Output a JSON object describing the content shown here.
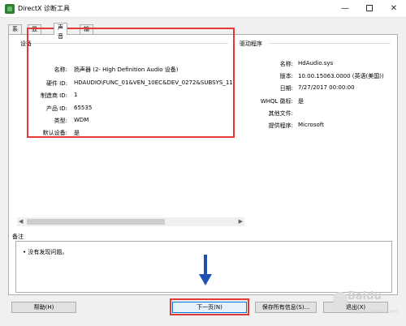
{
  "window": {
    "title": "DirectX 诊断工具",
    "controls": {
      "minimize": "—",
      "close": "✕"
    }
  },
  "tabs": [
    {
      "label": "系统"
    },
    {
      "label": "显示"
    },
    {
      "label": "声音"
    },
    {
      "label": "输入"
    }
  ],
  "device": {
    "group_title": "设备",
    "rows": [
      {
        "label": "名称:",
        "value": "扬声器 (2- High Definition Audio 设备)"
      },
      {
        "label": "硬件 ID:",
        "value": "HDAUDIO\\FUNC_01&VEN_10EC&DEV_0272&SUBSYS_11"
      },
      {
        "label": "制造商 ID:",
        "value": "1"
      },
      {
        "label": "产品 ID:",
        "value": "65535"
      },
      {
        "label": "类型:",
        "value": "WDM"
      },
      {
        "label": "默认设备:",
        "value": "是"
      }
    ]
  },
  "driver": {
    "group_title": "驱动程序",
    "rows": [
      {
        "label": "名称:",
        "value": "HdAudio.sys"
      },
      {
        "label": "版本:",
        "value": "10.00.15063.0000 (英语(美国))"
      },
      {
        "label": "日期:",
        "value": "7/27/2017 00:00:00"
      },
      {
        "label": "WHQL 徽标:",
        "value": "是"
      },
      {
        "label": "其他文件:",
        "value": ""
      },
      {
        "label": "提供程序:",
        "value": "Microsoft"
      }
    ]
  },
  "notes": {
    "label": "备注",
    "items": [
      "没有发现问题。"
    ]
  },
  "buttons": {
    "help": "帮助(H)",
    "next": "下一页(N)",
    "save": "保存所有信息(S)...",
    "exit": "退出(X)"
  },
  "watermark": {
    "text": "Baidu",
    "sub": "jingyan.baidu.com"
  },
  "colors": {
    "highlight": "#e53935",
    "arrow": "#2050b0"
  }
}
